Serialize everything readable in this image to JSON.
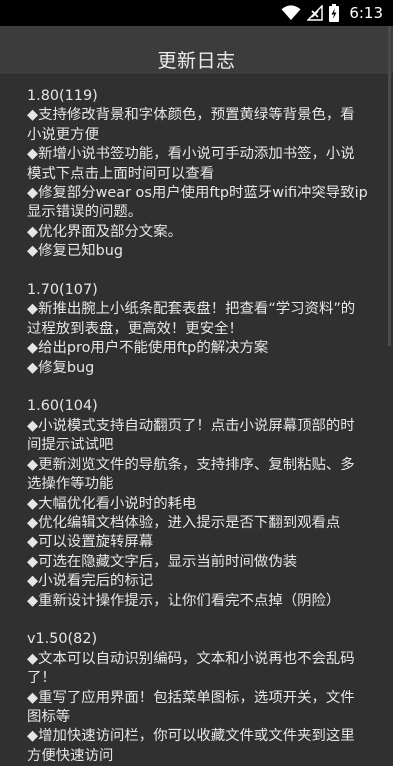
{
  "status_bar": {
    "time": "6:13",
    "icons": [
      "wifi-icon",
      "no-signal-icon",
      "battery-charging-icon"
    ]
  },
  "dialog": {
    "title": "更新日志",
    "releases": [
      {
        "version": "1.80(119)",
        "items": [
          "◆支持修改背景和字体颜色，预置黄绿等背景色，看小说更方便",
          "◆新增小说书签功能，看小说可手动添加书签，小说模式下点击上面时间可以查看",
          "◆修复部分wear os用户使用ftp时蓝牙wifi冲突导致ip显示错误的问题。",
          "◆优化界面及部分文案。",
          "◆修复已知bug"
        ]
      },
      {
        "version": "1.70(107)",
        "items": [
          "◆新推出腕上小纸条配套表盘！把查看“学习资料”的过程放到表盘，更高效！更安全！",
          "◆给出pro用户不能使用ftp的解决方案",
          "◆修复bug"
        ]
      },
      {
        "version": "1.60(104)",
        "items": [
          "◆小说模式支持自动翻页了！点击小说屏幕顶部的时间提示试试吧",
          "◆更新浏览文件的导航条，支持排序、复制粘贴、多选操作等功能",
          "◆大幅优化看小说时的耗电",
          "◆优化编辑文档体验，进入提示是否下翻到观看点",
          "◆可以设置旋转屏幕",
          "◆可选在隐藏文字后，显示当前时间做伪装",
          "◆小说看完后的标记",
          "◆重新设计操作提示，让你们看完不点掉（阴险）"
        ]
      },
      {
        "version": "v1.50(82)",
        "items": [
          "◆文本可以自动识别编码，文本和小说再也不会乱码了！",
          "◆重写了应用界面！包括菜单图标，选项开关，文件图标等",
          "◆增加快速访问栏，你可以收藏文件或文件夹到这里方便快速访问"
        ]
      }
    ]
  }
}
